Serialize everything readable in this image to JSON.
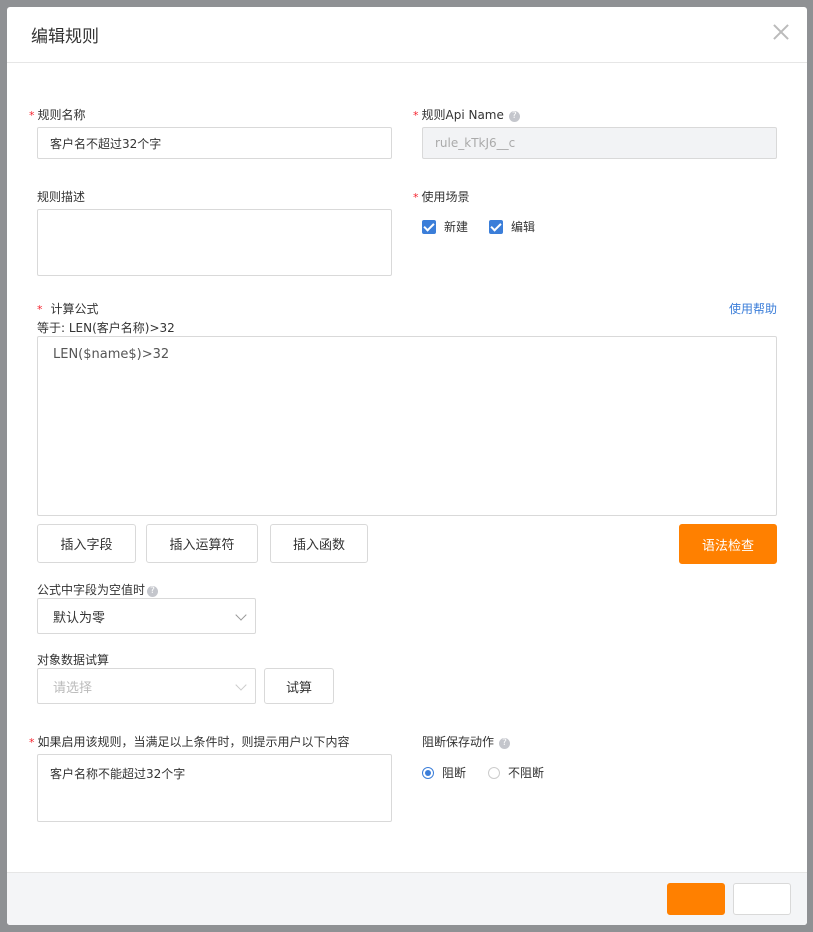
{
  "dialog": {
    "title": "编辑规则"
  },
  "form": {
    "rule_name": {
      "label": "规则名称",
      "value": "客户名不超过32个字"
    },
    "api_name": {
      "label": "规则Api Name",
      "value": "rule_kTkJ6__c"
    },
    "description": {
      "label": "规则描述",
      "value": ""
    },
    "scene": {
      "label": "使用场景",
      "options": [
        {
          "label": "新建",
          "checked": true
        },
        {
          "label": "编辑",
          "checked": true
        }
      ]
    },
    "formula": {
      "label": "计算公式",
      "help_link": "使用帮助",
      "equals_text": "等于: LEN(客户名称)>32",
      "value": "LEN($name$)>32",
      "buttons": {
        "insert_field": "插入字段",
        "insert_operator": "插入运算符",
        "insert_function": "插入函数",
        "syntax_check": "语法检查"
      }
    },
    "empty_field": {
      "label": "公式中字段为空值时",
      "value": "默认为零"
    },
    "trial": {
      "label": "对象数据试算",
      "placeholder": "请选择",
      "button": "试算"
    },
    "prompt": {
      "label": "如果启用该规则，当满足以上条件时，则提示用户以下内容",
      "value": "客户名称不能超过32个字"
    },
    "block": {
      "label": "阻断保存动作",
      "options": [
        {
          "label": "阻断",
          "selected": true
        },
        {
          "label": "不阻断",
          "selected": false
        }
      ]
    }
  },
  "colors": {
    "accent": "#ff8000",
    "link": "#3b7ed9",
    "required": "#f5222d"
  }
}
